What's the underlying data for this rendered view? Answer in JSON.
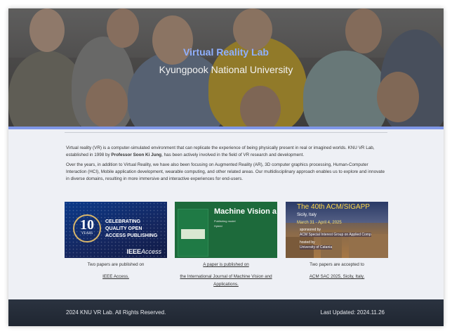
{
  "hero": {
    "title": "Virtual Reality Lab",
    "subtitle": "Kyungpook National University"
  },
  "intro": {
    "p1_a": "Virtual reality (VR) is a computer-simulated environment that can replicate the experience of being physically present in real or imagined worlds. KNU VR Lab, established in 1998 by ",
    "p1_bold": "Professor Soon Ki Jung",
    "p1_b": ", has been actively involved in the field of VR research and development.",
    "p2": "Over the years, in addition to Virtual Reality, we have also been focusing on Augmented Reality (AR), 3D computer graphics processing, Human-Computer Interaction (HCI), Mobile application development, wearable computing, and other related areas. Our multidisciplinary approach enables us to explore and innovate in diverse domains, resulting in more immersive and interactive experiences for end-users."
  },
  "cards": [
    {
      "image": {
        "badge_num": "10",
        "badge_years": "YEARS",
        "line1": "CELEBRATING",
        "line2": "QUALITY OPEN",
        "line3": "ACCESS PUBLISHING",
        "brand_a": "IEEE",
        "brand_b": "Access"
      },
      "caption": "Two papers are published on",
      "link": "IEEE Access."
    },
    {
      "image": {
        "title": "Machine Vision a",
        "note1": "Publishing model",
        "note2": "Hybrid"
      },
      "caption": "A paper is published on",
      "link": "the International Journal of Machine Vision and Applications."
    },
    {
      "image": {
        "title": "The 40th ACM/SIGAPP",
        "place": "Sicily, Italy",
        "dates": "March 31 - April 4, 2025",
        "sponsor_label": "sponsored by",
        "sponsor": "ACM Special Interest Group on Applied Comp",
        "host_label": "hosted by",
        "host": "University of Catania"
      },
      "caption": "Two papers are accepted to",
      "link": "ACM SAC 2025, Sicily, Italy."
    }
  ],
  "footer": {
    "copyright": "2024 KNU VR Lab. All Rights Reserved.",
    "updated": "Last Updated: 2024.11.26"
  },
  "colors": {
    "accent": "#7f97e8",
    "hero_title": "#8fb0ff",
    "footer_bg": "#232a35"
  }
}
